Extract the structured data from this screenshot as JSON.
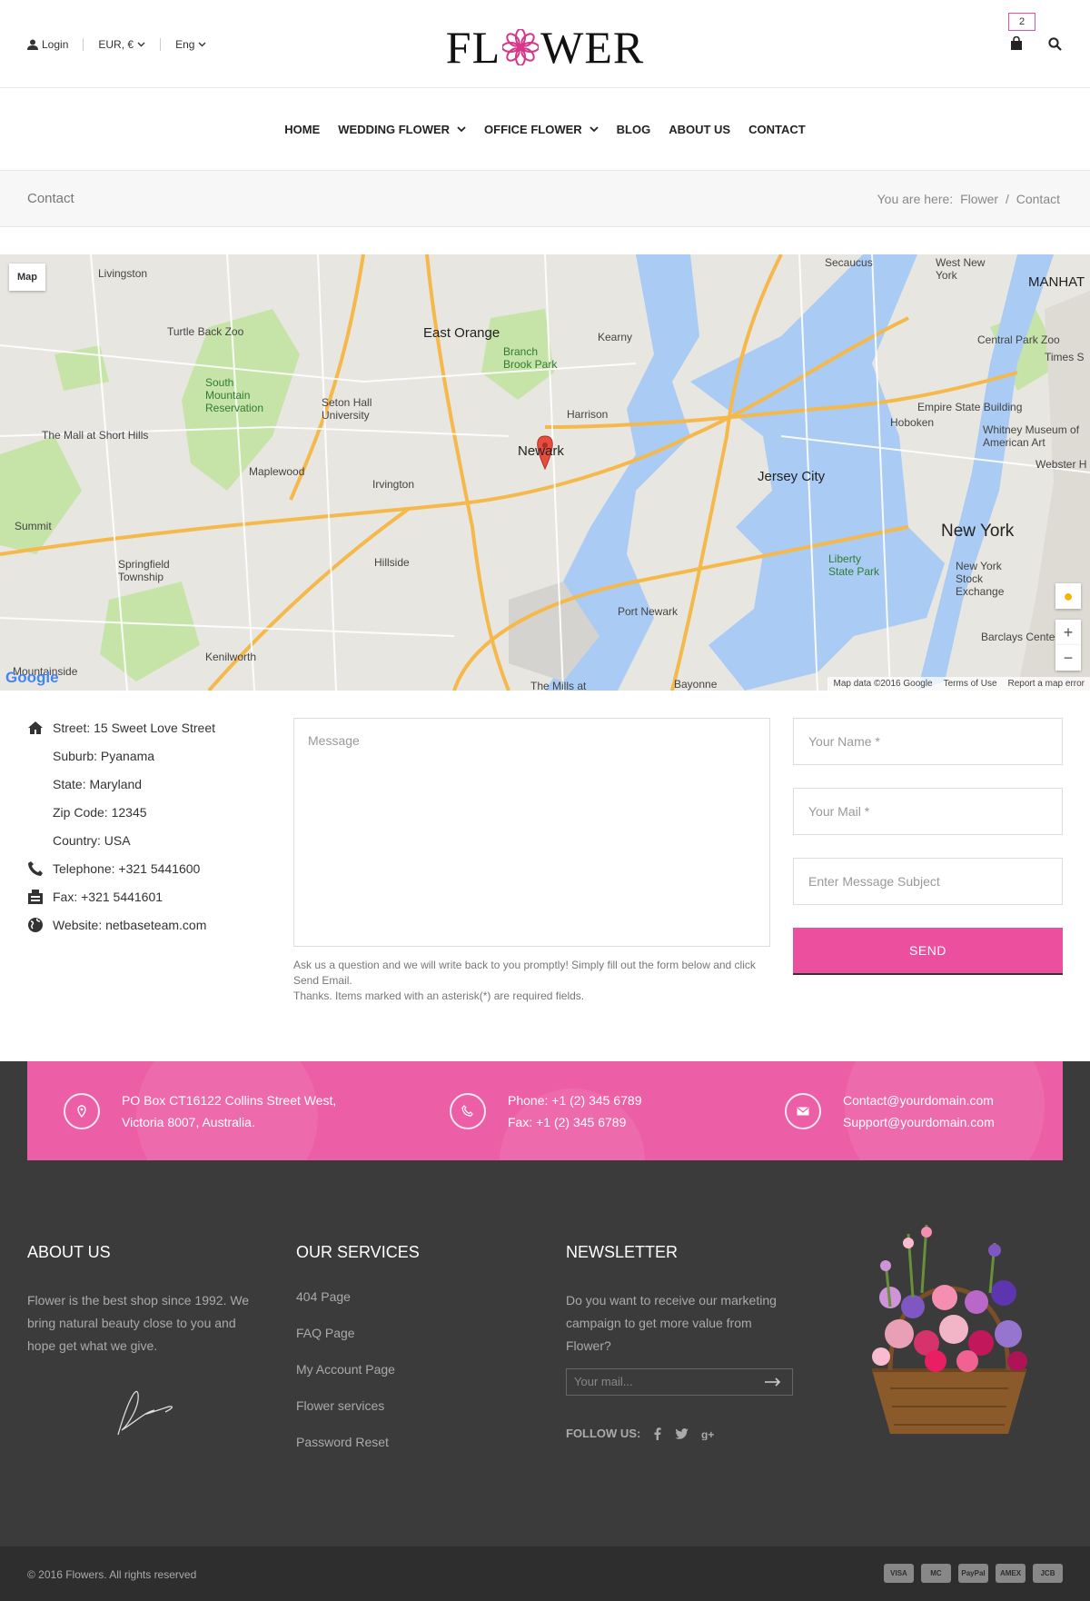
{
  "header": {
    "login": "Login",
    "currency": "EUR, €",
    "language": "Eng",
    "logo_left": "FL",
    "logo_right": "WER",
    "cart_count": "2"
  },
  "nav": {
    "items": [
      {
        "label": "HOME"
      },
      {
        "label": "WEDDING FLOWER"
      },
      {
        "label": "OFFICE FLOWER"
      },
      {
        "label": "BLOG"
      },
      {
        "label": "ABOUT US"
      },
      {
        "label": "CONTACT"
      }
    ]
  },
  "breadcrumb": {
    "title": "Contact",
    "prefix": "You are here:",
    "home": "Flower",
    "separator": "/",
    "current": "Contact"
  },
  "map": {
    "type_button": "Map",
    "labels": [
      "Livingston",
      "Turtle Back Zoo",
      "East Orange",
      "Branch Brook Park",
      "Kearny",
      "Secaucus",
      "West New York",
      "Central Park Zoo",
      "South Mountain Reservation",
      "Seton Hall University",
      "The Mall at Short Hills",
      "Newark",
      "Harrison",
      "Hoboken",
      "Empire State Building",
      "Maplewood",
      "Irvington",
      "Jersey City",
      "Summit",
      "Springfield Township",
      "Hillside",
      "New York",
      "Liberty State Park",
      "New York Stock Exchange",
      "Port Newark",
      "Kenilworth",
      "Barclays Center",
      "Bayonne",
      "The Mills at",
      "MANHAT",
      "Times S",
      "Whitney Museum of American Art",
      "Webster H",
      "Mountainside"
    ],
    "google": "Google",
    "footer_items": [
      "Map data ©2016 Google",
      "Terms of Use",
      "Report a map error"
    ],
    "zoom_in": "+",
    "zoom_out": "−"
  },
  "contact_info": {
    "street": "Street: 15 Sweet Love Street",
    "suburb": "Suburb: Pyanama",
    "state": "State: Maryland",
    "zip": "Zip Code: 12345",
    "country": "Country: USA",
    "telephone": "Telephone: +321 5441600",
    "fax": "Fax: +321 5441601",
    "website": "Website: netbaseteam.com"
  },
  "form": {
    "message_placeholder": "Message",
    "note_line1": "Ask us a question and we will write back to you promptly! Simply fill out the form below and click Send Email.",
    "note_line2": "Thanks. Items marked with an asterisk(*) are required fields.",
    "name_placeholder": "Your Name *",
    "mail_placeholder": "Your Mail *",
    "subject_placeholder": "Enter Message Subject",
    "send_label": "SEND"
  },
  "footer_band": {
    "address_1": "PO Box CT16122 Collins Street West,",
    "address_2": "Victoria 8007, Australia.",
    "phone": "Phone: +1 (2) 345 6789",
    "fax": "Fax: +1 (2) 345 6789",
    "email_1": "Contact@yourdomain.com",
    "email_2": "Support@yourdomain.com"
  },
  "footer": {
    "about_title": "ABOUT US",
    "about_text": "Flower is the best shop since 1992. We bring natural beauty close to you and hope get what we give.",
    "services_title": "OUR SERVICES",
    "services": [
      "404 Page",
      "FAQ Page",
      "My Account Page",
      "Flower services",
      "Password Reset"
    ],
    "newsletter_title": "NEWSLETTER",
    "newsletter_text": "Do you want to receive our marketing campaign to get more value from Flower?",
    "newsletter_placeholder": "Your mail...",
    "follow_label": "FOLLOW US:",
    "copyright": "© 2016 Flowers. All rights reserved",
    "payments": [
      "VISA",
      "MC",
      "PayPal",
      "AMEX",
      "JCB"
    ]
  },
  "colors": {
    "accent": "#ec4f9e",
    "footer_bg": "#3b3b3b",
    "bottom_bg": "#2e2e2e"
  }
}
